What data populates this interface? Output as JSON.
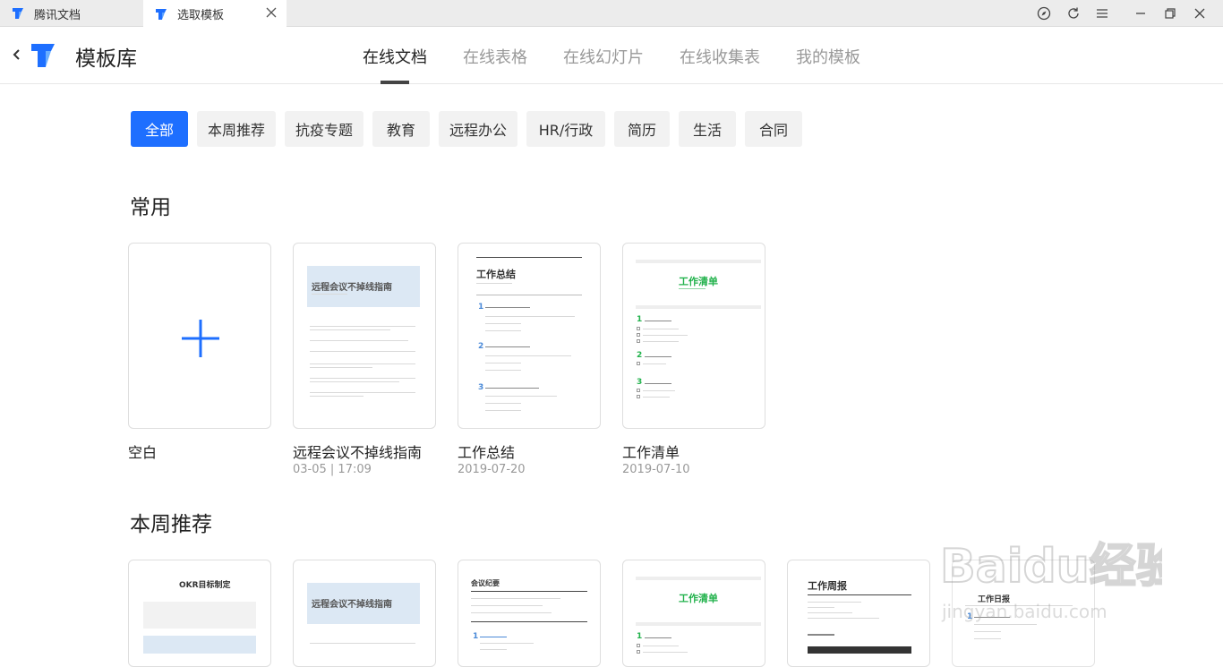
{
  "tabs": [
    {
      "label": "腾讯文档"
    },
    {
      "label": "选取模板"
    }
  ],
  "header": {
    "title": "模板库",
    "nav": [
      {
        "label": "在线文档"
      },
      {
        "label": "在线表格"
      },
      {
        "label": "在线幻灯片"
      },
      {
        "label": "在线收集表"
      },
      {
        "label": "我的模板"
      }
    ]
  },
  "categories": [
    {
      "label": "全部"
    },
    {
      "label": "本周推荐"
    },
    {
      "label": "抗疫专题"
    },
    {
      "label": "教育"
    },
    {
      "label": "远程办公"
    },
    {
      "label": "HR/行政"
    },
    {
      "label": "简历"
    },
    {
      "label": "生活"
    },
    {
      "label": "合同"
    }
  ],
  "sections": {
    "common": {
      "title": "常用",
      "cards": [
        {
          "name": "空白",
          "date": ""
        },
        {
          "name": "远程会议不掉线指南",
          "date": "03-05 | 17:09",
          "thumb_title": "远程会议不掉线指南"
        },
        {
          "name": "工作总结",
          "date": "2019-07-20",
          "thumb_title": "工作总结"
        },
        {
          "name": "工作清单",
          "date": "2019-07-10",
          "thumb_title": "工作清单"
        }
      ]
    },
    "weekly": {
      "title": "本周推荐",
      "cards": [
        {
          "thumb_title": "OKR目标制定"
        },
        {
          "thumb_title": "远程会议不掉线指南"
        },
        {
          "thumb_title": "会议纪要"
        },
        {
          "thumb_title": "工作清单"
        },
        {
          "thumb_title": "工作周报"
        },
        {
          "thumb_title": "工作日报"
        }
      ]
    }
  },
  "watermark": {
    "text": "Baidu经验",
    "sub": "jingyan.baidu.com"
  },
  "colors": {
    "accent": "#1e6fff",
    "green": "#22b24c",
    "thumbBlue": "#dce8f4"
  }
}
